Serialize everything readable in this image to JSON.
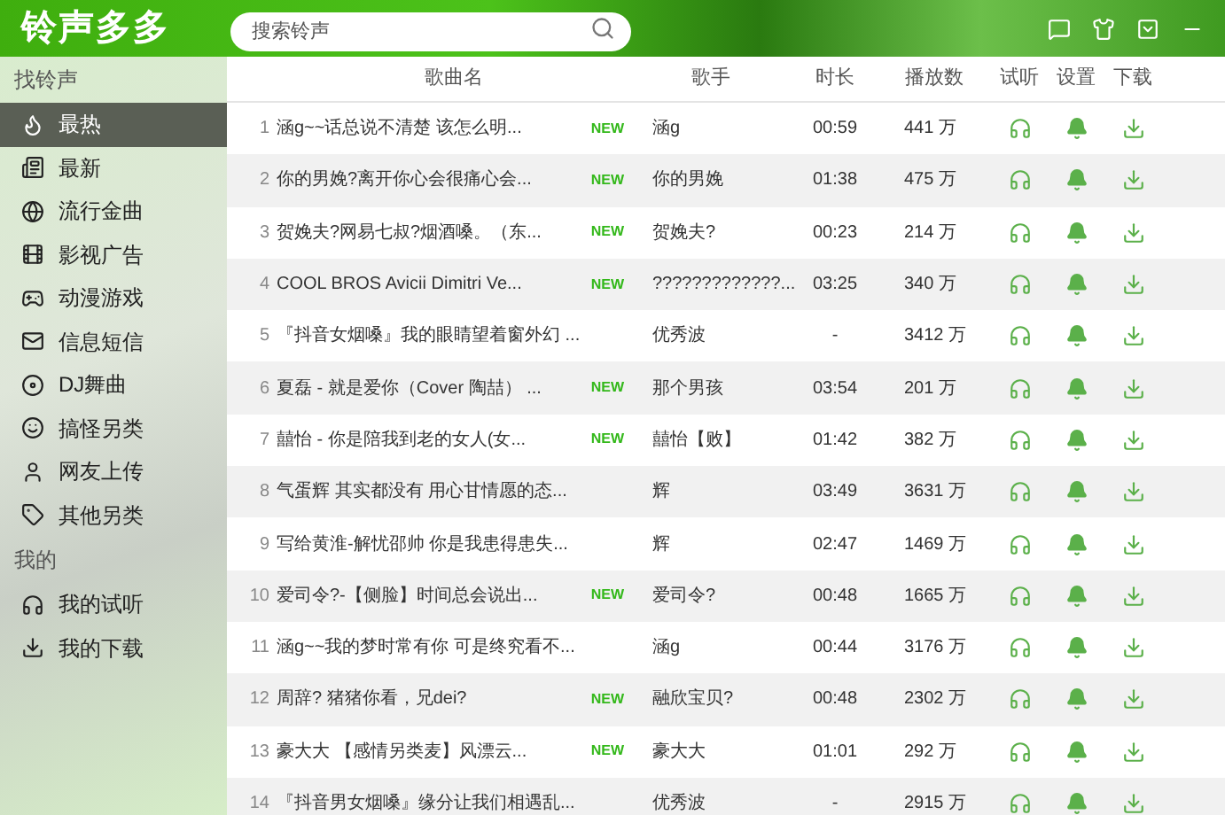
{
  "app": {
    "title": "铃声多多"
  },
  "search": {
    "placeholder": "搜索铃声"
  },
  "sidebar": {
    "sections": [
      {
        "heading": "找铃声",
        "items": [
          {
            "label": "最热",
            "selected": true
          },
          {
            "label": "最新",
            "selected": false
          },
          {
            "label": "流行金曲",
            "selected": false
          },
          {
            "label": "影视广告",
            "selected": false
          },
          {
            "label": "动漫游戏",
            "selected": false
          },
          {
            "label": "信息短信",
            "selected": false
          },
          {
            "label": "DJ舞曲",
            "selected": false
          },
          {
            "label": "搞怪另类",
            "selected": false
          },
          {
            "label": "网友上传",
            "selected": false
          },
          {
            "label": "其他另类",
            "selected": false
          }
        ]
      },
      {
        "heading": "我的",
        "items": [
          {
            "label": "我的试听",
            "selected": false
          },
          {
            "label": "我的下载",
            "selected": false
          }
        ]
      }
    ]
  },
  "table": {
    "columns": [
      "歌曲名",
      "歌手",
      "时长",
      "播放数",
      "试听",
      "设置",
      "下载"
    ],
    "rows": [
      {
        "index": "1",
        "name": "涵g~~话总说不清楚  该怎么明...",
        "badge": "NEW",
        "singer": "涵g",
        "duration": "00:59",
        "plays": "441 万"
      },
      {
        "index": "2",
        "name": "你的男娩?离开你心会很痛心会...",
        "badge": "NEW",
        "singer": "你的男娩",
        "duration": "01:38",
        "plays": "475 万"
      },
      {
        "index": "3",
        "name": "贺娩夫?网易七叔?烟酒嗓。（东...",
        "badge": "NEW",
        "singer": "贺娩夫?",
        "duration": "00:23",
        "plays": "214 万"
      },
      {
        "index": "4",
        "name": "COOL BROS Avicii Dimitri Ve...",
        "badge": "NEW",
        "singer": "?????????????...",
        "duration": "03:25",
        "plays": "340 万"
      },
      {
        "index": "5",
        "name": "『抖音女烟嗓』我的眼睛望着窗外幻 ...",
        "singer": "优秀波",
        "duration": "-",
        "plays": "3412 万"
      },
      {
        "index": "6",
        "name": "夏磊 - 就是爱你（Cover 陶喆） ...",
        "badge": "NEW",
        "singer": "那个男孩",
        "duration": "03:54",
        "plays": "201 万"
      },
      {
        "index": "7",
        "name": "囍怡 - 你是陪我到老的女人(女...",
        "badge": "NEW",
        "singer": "囍怡【败】",
        "duration": "01:42",
        "plays": "382 万"
      },
      {
        "index": "8",
        "name": "气蛋辉   其实都没有 用心甘情愿的态...",
        "singer": "辉",
        "duration": "03:49",
        "plays": "3631 万"
      },
      {
        "index": "9",
        "name": "写给黄淮-解忧邵帅     你是我患得患失...",
        "singer": "辉",
        "duration": "02:47",
        "plays": "1469 万"
      },
      {
        "index": "10",
        "name": "爱司令?-【侧脸】时间总会说出...",
        "badge": "NEW",
        "singer": "爱司令?",
        "duration": "00:48",
        "plays": "1665 万"
      },
      {
        "index": "11",
        "name": "涵g~~我的梦时常有你  可是终究看不...",
        "singer": "涵g",
        "duration": "00:44",
        "plays": "3176 万"
      },
      {
        "index": "12",
        "name": "周辞? 猪猪你看，兄dei?",
        "badge": "NEW",
        "singer": "融欣宝贝?",
        "duration": "00:48",
        "plays": "2302 万"
      },
      {
        "index": "13",
        "name": "豪大大  【感情另类麦】风漂云...",
        "badge": "NEW",
        "singer": "豪大大",
        "duration": "01:01",
        "plays": "292 万"
      },
      {
        "index": "14",
        "name": "『抖音男女烟嗓』缘分让我们相遇乱...",
        "singer": "优秀波",
        "duration": "-",
        "plays": "2915 万"
      }
    ]
  }
}
